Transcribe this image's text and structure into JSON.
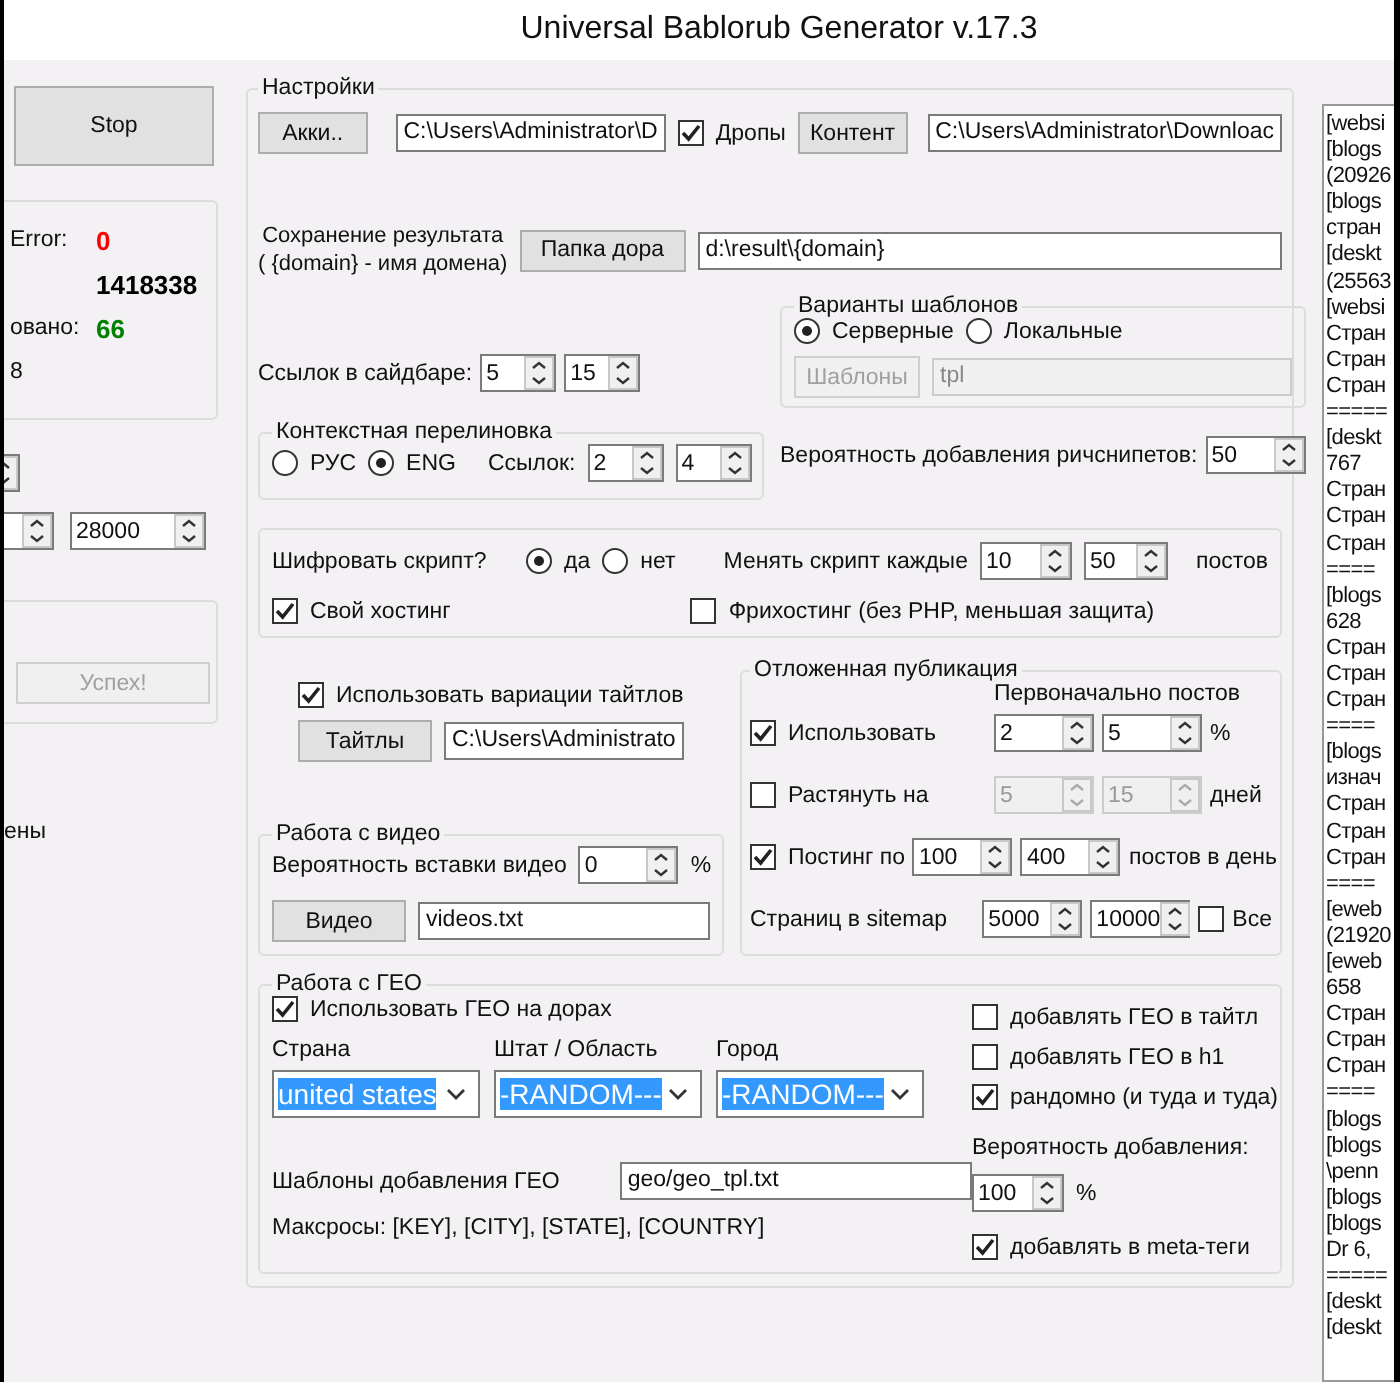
{
  "window": {
    "title": "Universal Bablorub Generator v.17.3"
  },
  "left_panel": {
    "stop_button": "Stop",
    "stats": [
      {
        "label": "Error:",
        "value": "0",
        "color": "#ff0000"
      },
      {
        "value": "1418338",
        "color": "#000000"
      },
      {
        "label": "овано:",
        "value": "66",
        "color": "#008000"
      },
      {
        "label": "8"
      }
    ],
    "limit": "28000",
    "success_button": {
      "label": "Успех!",
      "disabled": true
    },
    "note": "ены"
  },
  "settings": {
    "title": "Настройки",
    "accounts_button": "Акки..",
    "accounts_path": "C:\\Users\\Administrator\\D",
    "drops": {
      "label": "Дропы",
      "checked": true
    },
    "content_button": "Контент",
    "content_path": "C:\\Users\\Administrator\\Downloac",
    "result_label": "Сохранение результата\n( {domain} - имя домена)",
    "door_folder_button": "Папка дора",
    "result_path": "d:\\result\\{domain}",
    "sidebar_links": {
      "label": "Ссылок в сайдбаре:",
      "min": "5",
      "max": "15"
    },
    "templates": {
      "title": "Варианты шаблонов",
      "options": [
        {
          "label": "Серверные",
          "selected": true
        },
        {
          "label": "Локальные",
          "selected": false
        }
      ],
      "button": "Шаблоны",
      "path": "tpl",
      "disabled": true
    },
    "context_linking": {
      "title": "Контекстная перелиновка",
      "options": [
        {
          "label": "РУС",
          "selected": false
        },
        {
          "label": "ENG",
          "selected": true
        }
      ],
      "links_label": "Ссылок:",
      "min": "2",
      "max": "4"
    },
    "richsnippets": {
      "label": "Вероятность добавления ричснипетов:",
      "value": "50"
    },
    "encryption": {
      "label": "Шифровать скрипт?",
      "options": [
        {
          "label": "да",
          "selected": true
        },
        {
          "label": "нет",
          "selected": false
        }
      ],
      "change_label": "Менять скрипт каждые",
      "min": "10",
      "max": "50",
      "unit": "постов",
      "hosting": [
        {
          "label": "Свой хостинг",
          "checked": true
        },
        {
          "label": "Фрихостинг (без PHP, меньшая защита)",
          "checked": false
        }
      ]
    },
    "title_variations": {
      "label": "Использовать вариации тайтлов",
      "checked": true,
      "button": "Тайтлы",
      "path": "C:\\Users\\Administrato"
    },
    "video": {
      "title": "Работа с видео",
      "probability_label": "Вероятность вставки видео",
      "probability": "0",
      "unit": "%",
      "button": "Видео",
      "path": "videos.txt"
    },
    "delayed": {
      "title": "Отложенная публикация",
      "initial_label": "Первоначально постов",
      "rows": [
        {
          "kind": "checkbox",
          "label": "Использовать",
          "checked": true,
          "min": "2",
          "max": "5",
          "unit": "%",
          "disabled": false
        },
        {
          "kind": "checkbox",
          "label": "Растянуть на",
          "checked": false,
          "min": "5",
          "max": "15",
          "unit": "дней",
          "disabled": true
        },
        {
          "kind": "checkbox",
          "label": "Постинг по",
          "checked": true,
          "min": "100",
          "max": "400",
          "unit": "постов в день",
          "disabled": false
        },
        {
          "kind": "label",
          "label": "Страниц в sitemap",
          "min": "5000",
          "max": "10000",
          "extra": {
            "label": "Все",
            "checked": false
          },
          "disabled": false
        }
      ]
    },
    "geo": {
      "title": "Работа с ГЕО",
      "use": {
        "label": "Использовать ГЕО на дорах",
        "checked": true
      },
      "selects": [
        {
          "label": "Страна",
          "value": "united states"
        },
        {
          "label": "Штат / Область",
          "value": "-RANDOM---"
        },
        {
          "label": "Город",
          "value": "-RANDOM---"
        }
      ],
      "templates_label": "Шаблоны добавления ГЕО",
      "templates_path": "geo/geo_tpl.txt",
      "macros": "Максросы: [KEY], [CITY], [STATE], [COUNTRY]",
      "options": [
        {
          "label": "добавлять ГЕО в тайтл",
          "checked": false
        },
        {
          "label": "добавлять ГЕО в h1",
          "checked": false
        },
        {
          "label": "рандомно (и туда и туда)",
          "checked": true
        }
      ],
      "probability_label": "Вероятность добавления:",
      "probability": "100",
      "unit": "%",
      "meta": {
        "label": "добавлять в meta-теги",
        "checked": true
      }
    }
  },
  "log": {
    "lines": [
      "[websi",
      "[blogs",
      "(20926",
      "[blogs",
      "стран",
      "[deskt",
      "(25563",
      "[websi",
      "Стран",
      "Стран",
      "Стран",
      "=====",
      "[deskt",
      "767",
      "Стран",
      "Стран",
      "Стран",
      "====",
      "[blogs",
      "628",
      "Стран",
      "Стран",
      "Стран",
      "====",
      "[blogs",
      "изнач",
      "Стран",
      "Стран",
      "Стран",
      "====",
      "[eweb",
      "(21920",
      "[eweb",
      "658",
      "Стран",
      "Стран",
      "Стран",
      "====",
      "[blogs",
      "[blogs",
      "\\penn",
      "[blogs",
      "[blogs",
      "Dr 6,",
      "=====",
      "[deskt",
      "[deskt"
    ]
  }
}
